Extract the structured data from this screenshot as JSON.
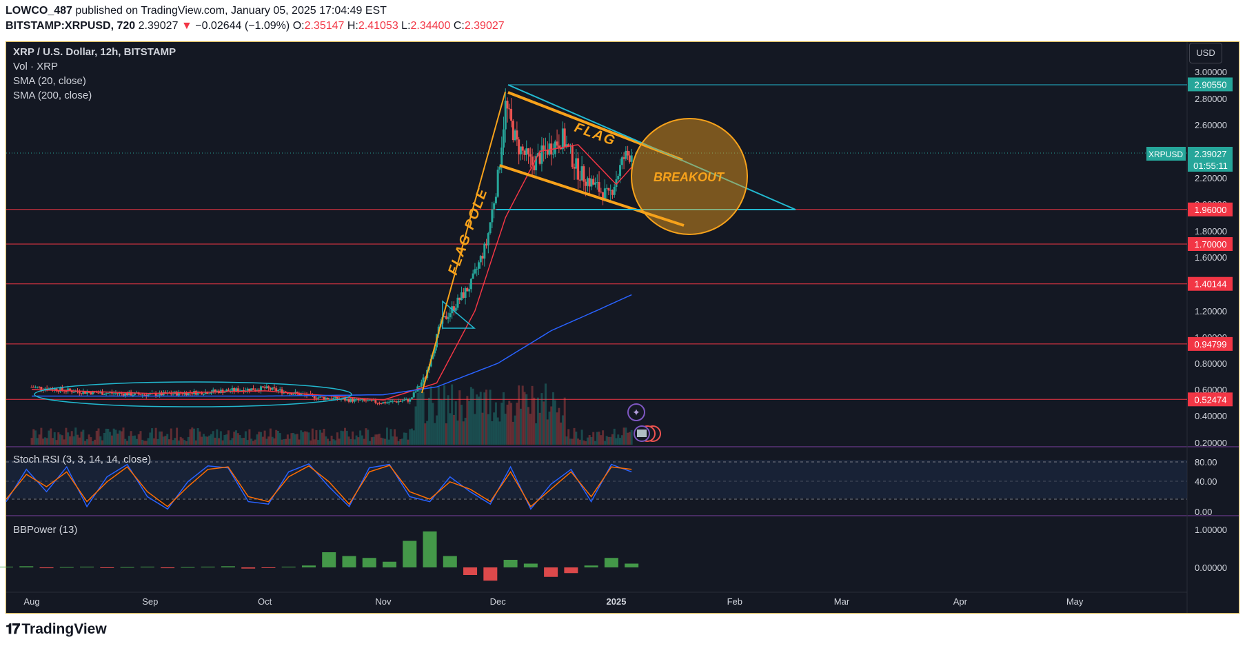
{
  "header": {
    "author": "LOWCO_487",
    "published_text": "published on TradingView.com, January 05, 2025 17:04:49 EST",
    "symbol": "BITSTAMP:XRPUSD, 720",
    "last": "2.39027",
    "change": "−0.02644 (−1.09%)",
    "change_arrow": "▼",
    "ohlc": {
      "o_label": "O:",
      "o": "2.35147",
      "h_label": "H:",
      "h": "2.41053",
      "l_label": "L:",
      "l": "2.34400",
      "c_label": "C:",
      "c": "2.39027"
    }
  },
  "legend": {
    "title": "XRP / U.S. Dollar, 12h, BITSTAMP",
    "vol": "Vol · XRP",
    "sma20": "SMA (20, close)",
    "sma200": "SMA (200, close)",
    "stoch": "Stoch RSI (3, 3, 14, 14, close)",
    "bbpower": "BBPower (13)"
  },
  "currency_button": "USD",
  "annotations": {
    "flag": "FLAG",
    "flag_pole": "FLAG POLE",
    "breakout": "BREAKOUT"
  },
  "price_label": {
    "symbol": "XRPUSD",
    "price": "2.39027",
    "countdown": "01:55:11"
  },
  "colors": {
    "background": "#141823",
    "up": "#26a69a",
    "down": "#ef5350",
    "annotation_orange": "#f7a21b",
    "trend_cyan": "#22b8cf",
    "level_red": "#f23645",
    "sma20": "#f23645",
    "sma200": "#2962ff",
    "stoch_k": "#2962ff",
    "stoch_d": "#ff6d00",
    "bb_green": "#4caf50",
    "bb_red": "#ff5252"
  },
  "footer": {
    "brand": "TradingView",
    "logo_icon": "tradingview-logo-icon"
  },
  "chart_data": [
    {
      "type": "line",
      "title": "XRP / U.S. Dollar, 12h, BITSTAMP",
      "x_tick_labels": [
        "Aug",
        "Sep",
        "Oct",
        "Nov",
        "Dec",
        "2025",
        "Feb",
        "Mar",
        "Apr",
        "May"
      ],
      "y_tick_labels": [
        "3.00000",
        "2.80000",
        "2.60000",
        "2.20000",
        "2.00000",
        "1.80000",
        "1.60000",
        "1.20000",
        "1.00000",
        "0.80000",
        "0.60000",
        "0.40000",
        "0.20000"
      ],
      "horizontal_levels": [
        "2.90550",
        "1.96000",
        "1.70000",
        "1.40144",
        "0.94799",
        "0.52474"
      ],
      "series": [
        {
          "name": "XRP / U.S. Dollar",
          "x": [
            "Aug 1",
            "Aug 15",
            "Sep 1",
            "Sep 15",
            "Oct 1",
            "Oct 15",
            "Nov 1",
            "Nov 8",
            "Nov 12",
            "Nov 16",
            "Nov 20",
            "Nov 24",
            "Nov 28",
            "Dec 1",
            "Dec 3",
            "Dec 6",
            "Dec 10",
            "Dec 14",
            "Dec 18",
            "Dec 22",
            "Dec 26",
            "Dec 30",
            "Jan 3",
            "Jan 5"
          ],
          "values": [
            0.62,
            0.58,
            0.56,
            0.58,
            0.61,
            0.54,
            0.5,
            0.52,
            0.7,
            1.1,
            1.25,
            1.4,
            1.7,
            2.2,
            2.75,
            2.45,
            2.3,
            2.42,
            2.5,
            2.25,
            2.15,
            2.05,
            2.35,
            2.39
          ]
        },
        {
          "name": "SMA (20, close)",
          "x": [
            "Aug 1",
            "Sep 1",
            "Oct 1",
            "Nov 1",
            "Nov 15",
            "Nov 25",
            "Dec 3",
            "Dec 12",
            "Dec 22",
            "Jan 1",
            "Jan 5"
          ],
          "values": [
            0.6,
            0.57,
            0.59,
            0.52,
            0.65,
            1.2,
            1.9,
            2.4,
            2.45,
            2.15,
            2.28
          ]
        },
        {
          "name": "SMA (200, close)",
          "x": [
            "Aug 1",
            "Sep 1",
            "Oct 1",
            "Nov 1",
            "Nov 15",
            "Dec 1",
            "Dec 15",
            "Jan 5"
          ],
          "values": [
            0.55,
            0.55,
            0.55,
            0.56,
            0.62,
            0.8,
            1.05,
            1.32
          ]
        }
      ]
    },
    {
      "type": "line",
      "title": "Stoch RSI (3, 3, 14, 14, close)",
      "y_tick_labels": [
        "80.00",
        "40.00",
        "0.00"
      ],
      "ylim": [
        0,
        100
      ],
      "series": [
        {
          "name": "K",
          "values": [
            20,
            85,
            40,
            90,
            10,
            70,
            95,
            30,
            5,
            60,
            92,
            88,
            20,
            15,
            80,
            96,
            50,
            10,
            88,
            95,
            30,
            20,
            70,
            40,
            15,
            90,
            5,
            55,
            85,
            20,
            95,
            80
          ]
        },
        {
          "name": "D",
          "values": [
            25,
            75,
            50,
            80,
            20,
            60,
            90,
            40,
            10,
            50,
            85,
            90,
            30,
            20,
            70,
            92,
            60,
            15,
            80,
            93,
            40,
            25,
            60,
            45,
            20,
            80,
            10,
            45,
            80,
            30,
            90,
            85
          ]
        }
      ]
    },
    {
      "type": "bar",
      "title": "BBPower (13)",
      "y_tick_labels": [
        "1.00000",
        "0.00000"
      ],
      "ylim": [
        -0.4,
        1.2
      ],
      "values": [
        0.02,
        0.03,
        -0.02,
        0.01,
        0.02,
        -0.01,
        0.01,
        0.02,
        -0.02,
        0.01,
        0.02,
        0.03,
        -0.03,
        -0.01,
        0.02,
        0.05,
        0.4,
        0.3,
        0.25,
        0.15,
        0.7,
        0.95,
        0.3,
        -0.2,
        -0.35,
        0.2,
        0.1,
        -0.25,
        -0.15,
        0.05,
        0.25,
        0.1
      ]
    }
  ]
}
